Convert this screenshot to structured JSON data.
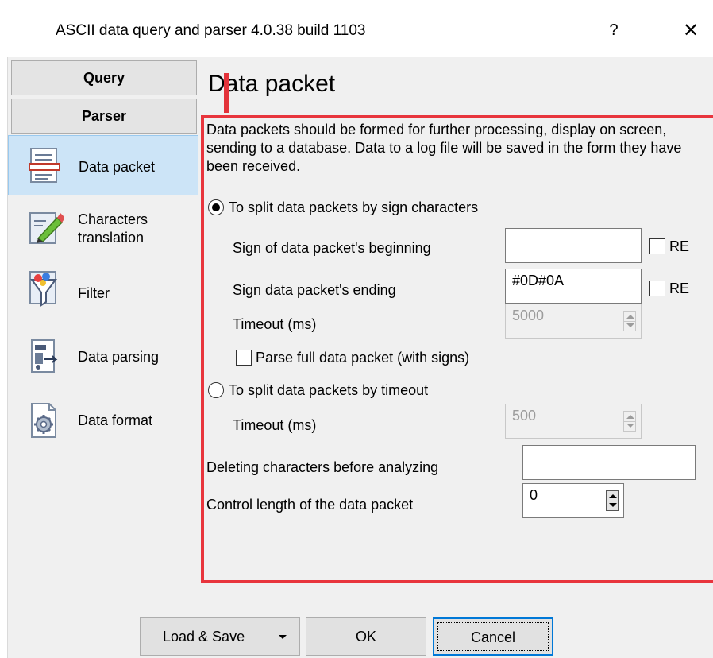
{
  "window": {
    "title": "ASCII data query and parser 4.0.38 build 1103",
    "help_label": "?",
    "close_label": "✕"
  },
  "sidebar": {
    "sections": [
      {
        "label": "Query"
      },
      {
        "label": "Parser"
      }
    ],
    "items": [
      {
        "label": "Data packet",
        "icon": "data-packet-icon",
        "active": true
      },
      {
        "label": "Characters\ntranslation",
        "icon": "pencil-icon",
        "active": false
      },
      {
        "label": "Filter",
        "icon": "funnel-icon",
        "active": false
      },
      {
        "label": "Data parsing",
        "icon": "parsing-icon",
        "active": false
      },
      {
        "label": "Data format",
        "icon": "gear-icon",
        "active": false
      }
    ]
  },
  "page": {
    "title": "Data packet",
    "description": "Data packets should be formed for further processing, display on screen, sending to a database. Data to a log file will be saved in the form they have been received.",
    "split_by_sign_label": "To split data packets by sign characters",
    "split_by_sign_selected": true,
    "sign_begin_label": "Sign of data packet's beginning",
    "sign_begin_value": "",
    "sign_end_label": "Sign data packet's ending",
    "sign_end_value": "#0D#0A",
    "re_label": "RE",
    "timeout_label": "Timeout (ms)",
    "sign_timeout_value": "5000",
    "parse_full_label": "Parse full data packet (with signs)",
    "split_by_timeout_label": "To split data packets by timeout",
    "split_by_timeout_selected": false,
    "split_timeout_value": "500",
    "deleting_label": "Deleting characters before analyzing",
    "deleting_value": "",
    "control_length_label": "Control length of the data packet",
    "control_length_value": "0"
  },
  "footer": {
    "load_save_label": "Load & Save",
    "ok_label": "OK",
    "cancel_label": "Cancel"
  },
  "colors": {
    "highlight_frame": "#e8353d",
    "active_item_bg": "#cce4f7",
    "default_button_border": "#0078d7"
  }
}
